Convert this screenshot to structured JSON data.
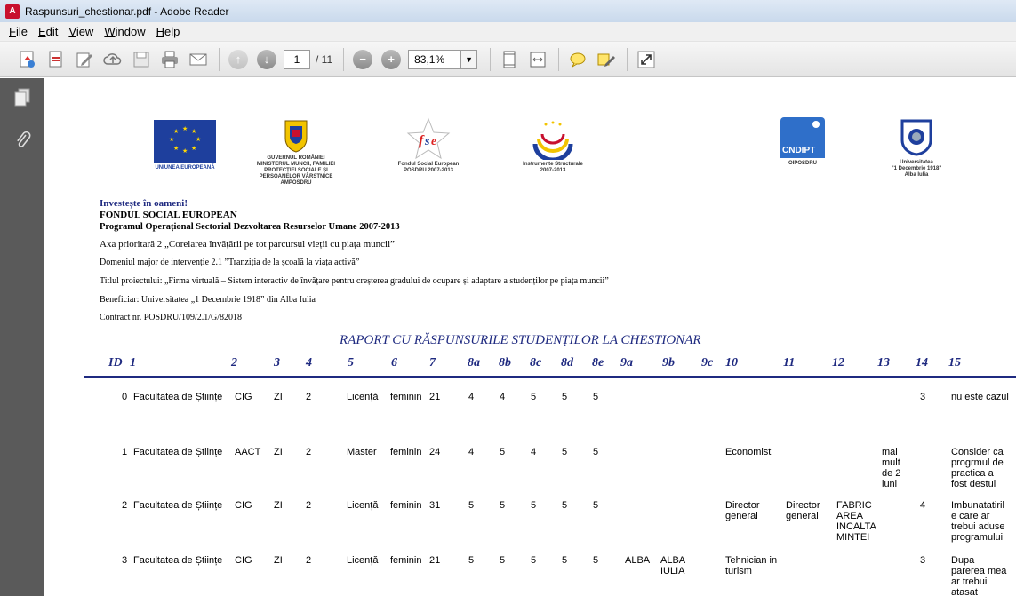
{
  "window": {
    "title": "Raspunsuri_chestionar.pdf - Adobe Reader",
    "app_icon": "adobe-reader-icon"
  },
  "menu": [
    "File",
    "Edit",
    "View",
    "Window",
    "Help"
  ],
  "toolbar": {
    "page_current": "1",
    "page_total": "/ 11",
    "zoom": "83,1%"
  },
  "logos": {
    "eu": "UNIUNEA EUROPEANĂ",
    "gov": "GUVERNUL ROMÂNIEI\nMINISTERUL MUNCII, FAMILIEI\nPROTECȚIEI SOCIALE ȘI\nPERSOANELOR VÂRSTNICE\nAMPOSDRU",
    "fse": "Fondul Social European\nPOSDRU 2007-2013",
    "is": "Instrumente Structurale\n2007-2013",
    "cndipt_mark": "CNDIPT",
    "cndipt": "OIPOSDRU",
    "univ": "Universitatea\n\"1 Decembrie 1918\"\nAlba Iulia"
  },
  "header": {
    "invest": "Investește în oameni!",
    "fund": "FONDUL SOCIAL EUROPEAN",
    "program": "Programul Operațional Sectorial Dezvoltarea Resurselor Umane 2007-2013",
    "axa": "Axa prioritară 2 „Corelarea învățării pe tot parcursul vieții cu piața muncii”",
    "domeniu": "Domeniul major de intervenție 2.1 ”Tranziția de la școală la viața activă”",
    "titlu": "Titlul proiectului: „Firma virtuală – Sistem interactiv de învățare pentru creșterea gradului de ocupare și adaptare a studenților pe piața muncii”",
    "beneficiar": "Beneficiar: Universitatea „1 Decembrie 1918” din Alba Iulia",
    "contract": "Contract nr. POSDRU/109/2.1/G/82018"
  },
  "report": {
    "title": "RAPORT CU RĂSPUNSURILE STUDENȚILOR LA CHESTIONAR",
    "columns": [
      "ID",
      "1",
      "2",
      "3",
      "4",
      "5",
      "6",
      "7",
      "8a",
      "8b",
      "8c",
      "8d",
      "8e",
      "9a",
      "9b",
      "9c",
      "10",
      "11",
      "12",
      "13",
      "14",
      "15"
    ],
    "rows": [
      {
        "id": "0",
        "c1": "Facultatea de Științe",
        "c2": "CIG",
        "c3": "ZI",
        "c4": "2",
        "c5": "Licență",
        "c6": "feminin",
        "c7": "21",
        "c8a": "4",
        "c8b": "4",
        "c8c": "5",
        "c8d": "5",
        "c8e": "5",
        "c9a": "",
        "c9b": "",
        "c9c": "",
        "c10": "",
        "c11": "",
        "c12": "",
        "c13": "",
        "c14": "3",
        "c15": "nu este cazul"
      },
      {
        "id": "1",
        "c1": "Facultatea de Științe",
        "c2": "AACT",
        "c3": "ZI",
        "c4": "2",
        "c5": "Master",
        "c6": "feminin",
        "c7": "24",
        "c8a": "4",
        "c8b": "5",
        "c8c": "4",
        "c8d": "5",
        "c8e": "5",
        "c9a": "",
        "c9b": "",
        "c9c": "",
        "c10": "Economist",
        "c11": "",
        "c12": "",
        "c13": "mai\nmult\nde 2\nluni",
        "c14": "",
        "c15": "Consider ca\nprogrmul de\npractica a\nfost destul"
      },
      {
        "id": "2",
        "c1": "Facultatea de Științe",
        "c2": "CIG",
        "c3": "ZI",
        "c4": "2",
        "c5": "Licență",
        "c6": "feminin",
        "c7": "31",
        "c8a": "5",
        "c8b": "5",
        "c8c": "5",
        "c8d": "5",
        "c8e": "5",
        "c9a": "",
        "c9b": "",
        "c9c": "",
        "c10": "Director\ngeneral",
        "c11": "Director\ngeneral",
        "c12": "FABRIC\nAREA\nINCALTA\nMINTEI",
        "c13": "",
        "c14": "4",
        "c15": "Imbunatatiril\ne care ar\ntrebui aduse\nprogramului"
      },
      {
        "id": "3",
        "c1": "Facultatea de Științe",
        "c2": "CIG",
        "c3": "ZI",
        "c4": "2",
        "c5": "Licență",
        "c6": "feminin",
        "c7": "21",
        "c8a": "5",
        "c8b": "5",
        "c8c": "5",
        "c8d": "5",
        "c8e": "5",
        "c9a": "ALBA",
        "c9b": "ALBA\nIULIA",
        "c9c": "",
        "c10": "Tehnician in\nturism",
        "c11": "",
        "c12": "",
        "c13": "",
        "c14": "3",
        "c15": "Dupa\nparerea mea\nar trebui\natasat"
      }
    ]
  }
}
